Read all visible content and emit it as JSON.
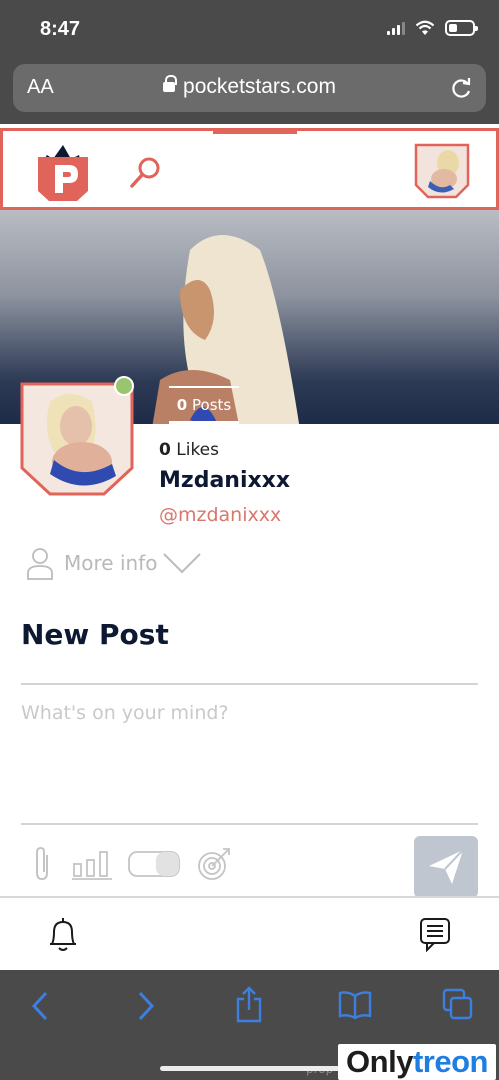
{
  "status_bar": {
    "time": "8:47"
  },
  "browser": {
    "text_size_label": "AA",
    "url": "pocketstars.com"
  },
  "profile": {
    "posts_count": "0",
    "posts_label": "Posts",
    "likes_count": "0",
    "likes_label": "Likes",
    "display_name": "Mzdanixxx",
    "handle": "@mzdanixxx",
    "more_info_label": "More info"
  },
  "composer": {
    "title": "New Post",
    "placeholder": "What's on your mind?"
  },
  "footer": {
    "partial_text": "prop",
    "watermark_part1": "Only",
    "watermark_part2": "treon"
  },
  "colors": {
    "brand": "#e0645a",
    "online": "#9bc46e",
    "heading": "#0d1833",
    "send_disabled": "#c0c6cf",
    "safari_icons": "#3d7fe0"
  },
  "icons": [
    "signal-icon",
    "wifi-icon",
    "battery-icon",
    "lock-icon",
    "reload-icon",
    "logo-icon",
    "search-icon",
    "user-icon",
    "chevron-down-icon",
    "attachment-icon",
    "poll-icon",
    "toggle-icon",
    "target-icon",
    "send-icon",
    "bell-icon",
    "chat-icon",
    "back-icon",
    "forward-icon",
    "share-icon",
    "bookmarks-icon",
    "tabs-icon"
  ]
}
